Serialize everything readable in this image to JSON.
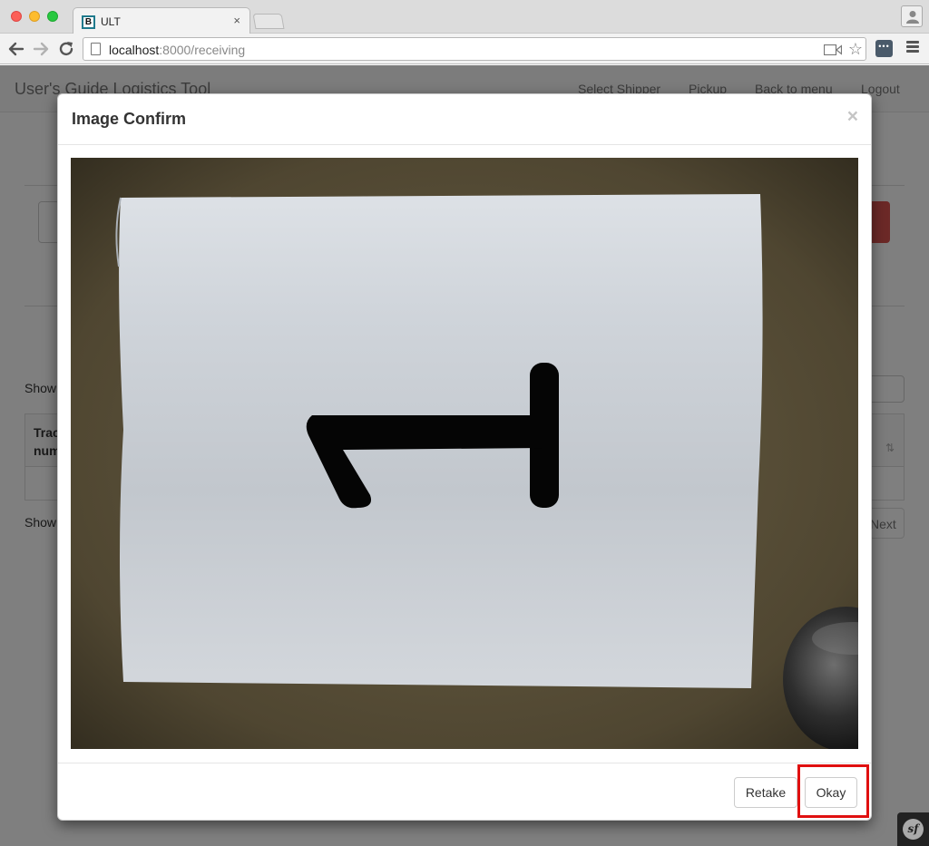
{
  "browser": {
    "tab_title": "ULT",
    "tab_favicon_letter": "B",
    "tab_close": "×",
    "url_host": "localhost",
    "url_rest": ":8000/receiving",
    "extension_label": "•••"
  },
  "page": {
    "brand": "User's Guide Logistics Tool",
    "nav": [
      "Select Shipper",
      "Pickup",
      "Back to menu",
      "Logout"
    ],
    "show_entries_top": "Show",
    "show_entries_bottom": "Show",
    "table_header": "Tracking number",
    "sort_glyph": "⇅",
    "next_label": "Next"
  },
  "modal": {
    "title": "Image Confirm",
    "close": "×",
    "image_alt": "Captured photo of a sheet of paper showing the digit 1",
    "retake_label": "Retake",
    "okay_label": "Okay"
  },
  "footer_badge": "sf",
  "colors": {
    "highlight": "#e01010",
    "danger": "#d9534f",
    "backdrop": "rgba(0,0,0,0.5)"
  }
}
